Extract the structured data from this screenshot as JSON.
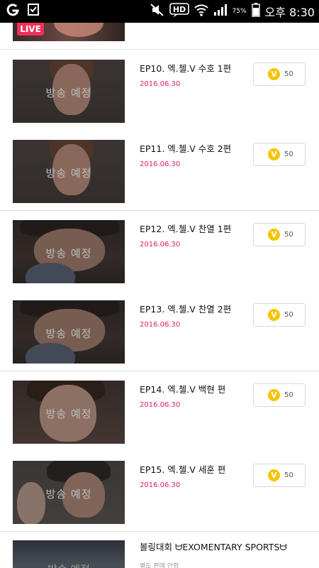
{
  "status_bar": {
    "time": "오후 8:30",
    "battery_pct": "75%",
    "hd_label": "HD",
    "icons": [
      "g-logo-icon",
      "notification-check-icon",
      "mute-icon",
      "hd-voice-icon",
      "wifi-icon",
      "signal-icon",
      "battery-icon"
    ]
  },
  "top_item": {
    "live_badge": "LIVE"
  },
  "episodes": [
    {
      "title": "EP10. 엑.첼.V 수호 1편",
      "date": "2016.06.30",
      "thumb_caption": "방송 예정",
      "coin_symbol": "V",
      "price": "50"
    },
    {
      "title": "EP11. 엑.첼.V 수호 2편",
      "date": "2016.06.30",
      "thumb_caption": "방송 예정",
      "coin_symbol": "V",
      "price": "50"
    },
    {
      "title": "EP12. 엑.첼.V 찬열 1편",
      "date": "2016.06.30",
      "thumb_caption": "방송 예정",
      "coin_symbol": "V",
      "price": "50"
    },
    {
      "title": "EP13. 엑.첼.V 찬열 2편",
      "date": "2016.06.30",
      "thumb_caption": "방송 예정",
      "coin_symbol": "V",
      "price": "50"
    },
    {
      "title": "EP14. 엑.첼.V 백현 편",
      "date": "2016.06.30",
      "thumb_caption": "방송 예정",
      "coin_symbol": "V",
      "price": "50"
    },
    {
      "title": "EP15. 엑.첼.V 세훈 편",
      "date": "2016.06.30",
      "thumb_caption": "방송 예정",
      "coin_symbol": "V",
      "price": "50"
    }
  ],
  "last_item": {
    "title": "볼링대회 ᗨEXOMENTARY SPORTSᗨ",
    "subtitle": "별도 판매 안함",
    "thumb_caption": "방송 예정"
  },
  "colors": {
    "accent_pink": "#e01c6a",
    "live_red": "#f0305a",
    "coin_yellow": "#f5c400"
  }
}
